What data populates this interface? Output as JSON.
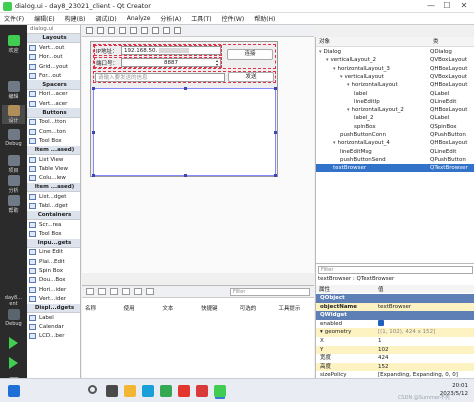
{
  "window": {
    "title": "dialog.ui - day8_23021_client - Qt Creator",
    "min": "—",
    "max": "☐",
    "close": "✕"
  },
  "menu": [
    "文件(F)",
    "编辑(E)",
    "构建(B)",
    "调试(D)",
    "Analyze",
    "分析(A)",
    "工具(T)",
    "控件(W)",
    "帮助(H)"
  ],
  "modes": [
    {
      "label": "欢迎",
      "icon": "qt-logo-icon",
      "color": "#41cd52"
    },
    {
      "label": "编辑",
      "icon": "edit-icon",
      "color": "#6f7a86"
    },
    {
      "label": "设计",
      "icon": "design-icon",
      "color": "#b08e5a"
    },
    {
      "label": "Debug",
      "icon": "debug-icon",
      "color": "#6f7a86"
    },
    {
      "label": "项目",
      "icon": "projects-icon",
      "color": "#6f7a86"
    },
    {
      "label": "分析",
      "icon": "analyze-icon",
      "color": "#6f7a86"
    },
    {
      "label": "帮助",
      "icon": "help-icon",
      "color": "#6f7a86"
    }
  ],
  "kit": {
    "name": "day8…ent",
    "mode": "Debug"
  },
  "widgetbox": {
    "filter": "Filter",
    "file_tab": "dialog.ui",
    "rows": [
      {
        "t": "cat",
        "label": "Layouts"
      },
      {
        "t": "item",
        "label": "Vert...out"
      },
      {
        "t": "item",
        "label": "Hor...out"
      },
      {
        "t": "item",
        "label": "Grid...yout"
      },
      {
        "t": "item",
        "label": "For...out"
      },
      {
        "t": "cat",
        "label": "Spacers"
      },
      {
        "t": "item",
        "label": "Hori...acer"
      },
      {
        "t": "item",
        "label": "Vert...acer"
      },
      {
        "t": "cat",
        "label": "Buttons"
      },
      {
        "t": "item",
        "label": "Tool...tton"
      },
      {
        "t": "item",
        "label": "Com...ton"
      },
      {
        "t": "item",
        "label": "Tool Box"
      },
      {
        "t": "cat",
        "label": "Item ...ased)"
      },
      {
        "t": "item",
        "label": "List View"
      },
      {
        "t": "item",
        "label": "Table View"
      },
      {
        "t": "item",
        "label": "Colu...iew"
      },
      {
        "t": "cat",
        "label": "Item ...ased)"
      },
      {
        "t": "item",
        "label": "List...dget"
      },
      {
        "t": "item",
        "label": "Tabl...dget"
      },
      {
        "t": "cat",
        "label": "Containers"
      },
      {
        "t": "item",
        "label": "Scr...rea"
      },
      {
        "t": "item",
        "label": "Tool Box"
      },
      {
        "t": "cat",
        "label": "Inpu...gets"
      },
      {
        "t": "item",
        "label": "Line Edit"
      },
      {
        "t": "item",
        "label": "Plai...Edit"
      },
      {
        "t": "item",
        "label": "Spin Box"
      },
      {
        "t": "item",
        "label": "Dou...Box"
      },
      {
        "t": "item",
        "label": "Hori...ider"
      },
      {
        "t": "item",
        "label": "Vert...ider"
      },
      {
        "t": "cat",
        "label": "Displ...dgets"
      },
      {
        "t": "item",
        "label": "Label"
      },
      {
        "t": "item",
        "label": "Calendar"
      },
      {
        "t": "item",
        "label": "LCD...ber"
      }
    ]
  },
  "form": {
    "ip_label": "IP地址：",
    "ip_value": "192.168.50.",
    "port_label": "端口号：",
    "port_value": "8887",
    "connect_button": "连接",
    "msg_placeholder": "请输入要发送的信息",
    "send_button": "发送"
  },
  "actions": {
    "filter": "Filter",
    "columns": [
      "名称",
      "使用",
      "文本",
      "快捷键",
      "可选的",
      "工具提示"
    ]
  },
  "object_inspector": {
    "headers": [
      "对象",
      "类"
    ],
    "rows": [
      {
        "indent": 0,
        "name": "Dialog",
        "cls": "QDialog",
        "tri": "▾"
      },
      {
        "indent": 1,
        "name": "verticalLayout_2",
        "cls": "QVBoxLayout",
        "tri": "▾"
      },
      {
        "indent": 2,
        "name": "horizontalLayout_3",
        "cls": "QHBoxLayout",
        "tri": "▾"
      },
      {
        "indent": 3,
        "name": "verticalLayout",
        "cls": "QVBoxLayout",
        "tri": "▾"
      },
      {
        "indent": 4,
        "name": "horizontalLayout",
        "cls": "QHBoxLayout",
        "tri": "▾"
      },
      {
        "indent": 5,
        "name": "label",
        "cls": "QLabel",
        "tri": ""
      },
      {
        "indent": 5,
        "name": "lineEditIp",
        "cls": "QLineEdit",
        "tri": ""
      },
      {
        "indent": 4,
        "name": "horizontalLayout_2",
        "cls": "QHBoxLayout",
        "tri": "▾"
      },
      {
        "indent": 5,
        "name": "label_2",
        "cls": "QLabel",
        "tri": ""
      },
      {
        "indent": 5,
        "name": "spinBox",
        "cls": "QSpinBox",
        "tri": ""
      },
      {
        "indent": 3,
        "name": "pushButtonConn",
        "cls": "QPushButton",
        "tri": ""
      },
      {
        "indent": 2,
        "name": "horizontalLayout_4",
        "cls": "QHBoxLayout",
        "tri": "▾"
      },
      {
        "indent": 3,
        "name": "lineEditMsg",
        "cls": "QLineEdit",
        "tri": ""
      },
      {
        "indent": 3,
        "name": "pushButtonSend",
        "cls": "QPushButton",
        "tri": ""
      },
      {
        "indent": 2,
        "name": "textBrowser",
        "cls": "QTextBrowser",
        "tri": "",
        "selected": true
      }
    ]
  },
  "property_editor": {
    "filter": "Filter",
    "object": "textBrowser : QTextBrowser",
    "headers": [
      "属性",
      "值"
    ],
    "rows": [
      {
        "t": "cat",
        "name": "QObject",
        "value": ""
      },
      {
        "t": "y",
        "name": "objectName",
        "value": "textBrowser",
        "bold": true
      },
      {
        "t": "cat",
        "name": "QWidget",
        "value": ""
      },
      {
        "t": "w",
        "name": "enabled",
        "value": "",
        "check": true
      },
      {
        "t": "y",
        "name": "geometry",
        "value": "[(1, 102), 424 x 152]",
        "tri": "▾"
      },
      {
        "t": "w",
        "name": "X",
        "value": "1"
      },
      {
        "t": "y",
        "name": "Y",
        "value": "102"
      },
      {
        "t": "w",
        "name": "宽度",
        "value": "424"
      },
      {
        "t": "y",
        "name": "高度",
        "value": "152"
      },
      {
        "t": "w",
        "name": "sizePolicy",
        "value": "[Expanding, Expanding, 0, 0]"
      }
    ]
  },
  "taskbar": {
    "time": "20:01",
    "date": "2023/5/12",
    "watermark": "CSDN @Summer不秃",
    "apps": [
      {
        "icon": "windows-icon",
        "color": "#1f6fd6"
      },
      {
        "icon": "search-icon",
        "color": "#555555"
      },
      {
        "icon": "task-view-icon",
        "color": "#4a4a4a"
      },
      {
        "icon": "file-explorer-icon",
        "color": "#f2b632"
      },
      {
        "icon": "edge-icon",
        "color": "#1aa0d8"
      },
      {
        "icon": "chrome-icon",
        "color": "#34a853"
      },
      {
        "icon": "wps-icon",
        "color": "#e2362e"
      },
      {
        "icon": "pdf-icon",
        "color": "#d93a3a"
      },
      {
        "icon": "qt-creator-icon",
        "color": "#41cd52"
      }
    ]
  }
}
